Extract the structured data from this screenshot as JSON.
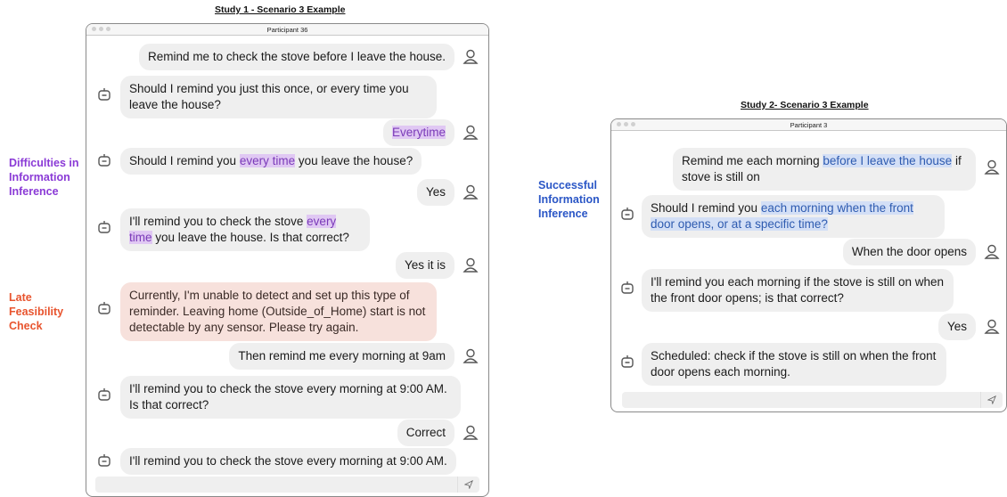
{
  "study1": {
    "title": "Study 1 - Scenario 3 Example",
    "window_title": "Participant 36",
    "labels": {
      "difficulties": [
        "Difficulties in",
        "Information",
        "Inference"
      ],
      "late": [
        "Late",
        "Feasibility",
        "Check"
      ]
    },
    "messages": {
      "m1": "Remind me to check the stove before I leave the house.",
      "m2": "Should I remind you just this once, or every time you leave the house?",
      "m3": "Everytime",
      "m4_pre": "Should I remind you ",
      "m4_hl": "every time",
      "m4_post": " you leave the house?",
      "m5": "Yes",
      "m6_pre": "I'll remind you to check the stove ",
      "m6_hl": "every time",
      "m6_post": " you leave the house. Is that correct?",
      "m7": "Yes it is",
      "m8": "Currently, I'm unable to detect and set up this type of reminder. Leaving home (Outside_of_Home) start is not detectable by any sensor. Please try again.",
      "m9": "Then remind me every morning at 9am",
      "m10": "I'll remind you to check the stove every morning at 9:00 AM. Is that correct?",
      "m11": "Correct",
      "m12": "I'll remind you to check the stove every morning at 9:00 AM."
    }
  },
  "study2": {
    "title": "Study 2- Scenario 3 Example",
    "window_title": "Participant 3",
    "label": [
      "Successful",
      "Information",
      "Inference"
    ],
    "messages": {
      "m1_pre": "Remind me each morning ",
      "m1_hl": "before I leave the house",
      "m1_post": " if stove is still on",
      "m2_pre": "Should I remind you ",
      "m2_hl": "each morning when the front door opens, or at a specific time?",
      "m3": "When the door opens",
      "m4": "I'll remind you each morning if the stove is still on when the front door opens; is that correct?",
      "m5": "Yes",
      "m6": "Scheduled: check if the stove is still on when the front door opens each morning."
    }
  },
  "colors": {
    "purple_label": "#8a3ad6",
    "orange_label": "#e8542e",
    "blue_label": "#2a56c6"
  },
  "icons": {
    "user": "user-icon",
    "bot": "robot-icon",
    "send": "send-icon"
  }
}
